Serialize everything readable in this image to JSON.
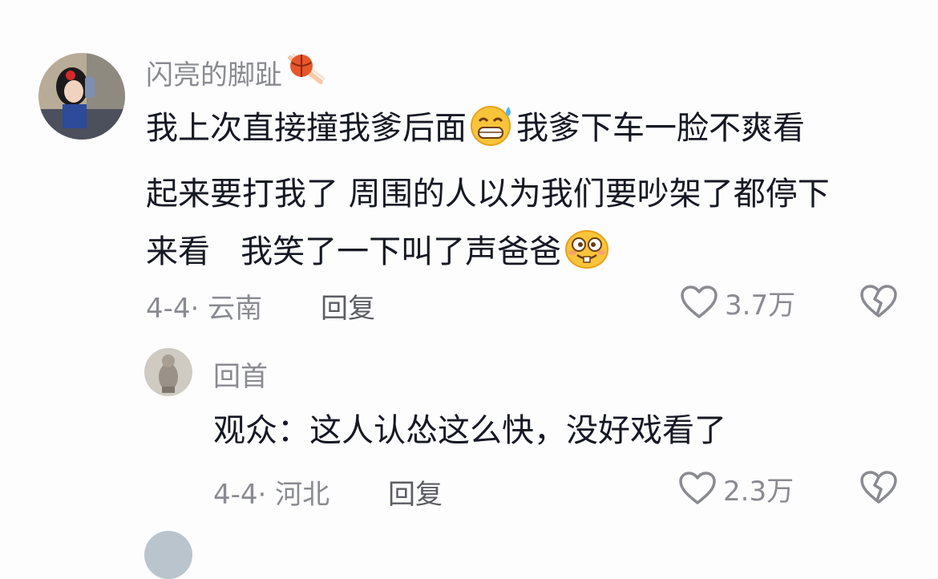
{
  "comments": [
    {
      "username": "闪亮的脚趾",
      "badge_icon": "basketball-icon",
      "text_lines": [
        [
          "我上次直接撞我爹后面",
          "我爹下车一脸不爽看"
        ],
        [
          "起来要打我了 周围的人以为我们要吵架了都停下"
        ],
        [
          "来看   我笑了一下叫了声爸爸"
        ]
      ],
      "emojis": [
        "grin-sweat-emoji",
        "buck-teeth-smile-emoji"
      ],
      "date": "4-4",
      "location": "云南",
      "reply_label": "回复",
      "likes": "3.7万"
    },
    {
      "username": "回首",
      "text": "观众：这人认怂这么快，没好戏看了",
      "date": "4-4",
      "location": "河北",
      "reply_label": "回复",
      "likes": "2.3万"
    }
  ],
  "colors": {
    "text": "#161823",
    "muted": "#8a8b91",
    "reply": "#5c5d63",
    "background": "#fdfdfd"
  }
}
